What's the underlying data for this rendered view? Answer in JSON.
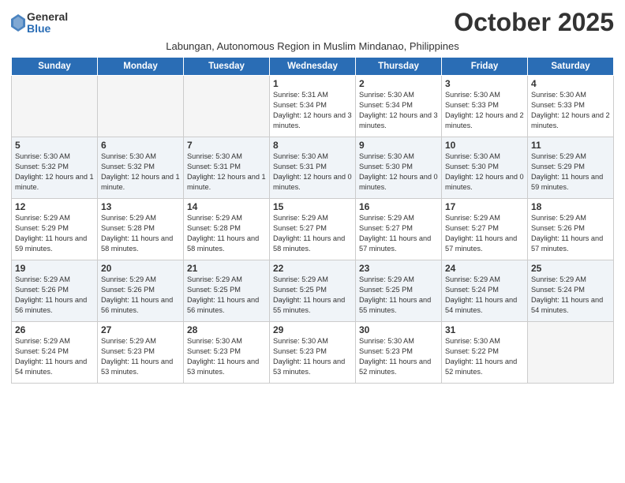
{
  "logo": {
    "general": "General",
    "blue": "Blue"
  },
  "title": "October 2025",
  "subtitle": "Labungan, Autonomous Region in Muslim Mindanao, Philippines",
  "headers": [
    "Sunday",
    "Monday",
    "Tuesday",
    "Wednesday",
    "Thursday",
    "Friday",
    "Saturday"
  ],
  "weeks": [
    [
      {
        "day": "",
        "info": ""
      },
      {
        "day": "",
        "info": ""
      },
      {
        "day": "",
        "info": ""
      },
      {
        "day": "1",
        "info": "Sunrise: 5:31 AM\nSunset: 5:34 PM\nDaylight: 12 hours and 3 minutes."
      },
      {
        "day": "2",
        "info": "Sunrise: 5:30 AM\nSunset: 5:34 PM\nDaylight: 12 hours and 3 minutes."
      },
      {
        "day": "3",
        "info": "Sunrise: 5:30 AM\nSunset: 5:33 PM\nDaylight: 12 hours and 2 minutes."
      },
      {
        "day": "4",
        "info": "Sunrise: 5:30 AM\nSunset: 5:33 PM\nDaylight: 12 hours and 2 minutes."
      }
    ],
    [
      {
        "day": "5",
        "info": "Sunrise: 5:30 AM\nSunset: 5:32 PM\nDaylight: 12 hours and 1 minute."
      },
      {
        "day": "6",
        "info": "Sunrise: 5:30 AM\nSunset: 5:32 PM\nDaylight: 12 hours and 1 minute."
      },
      {
        "day": "7",
        "info": "Sunrise: 5:30 AM\nSunset: 5:31 PM\nDaylight: 12 hours and 1 minute."
      },
      {
        "day": "8",
        "info": "Sunrise: 5:30 AM\nSunset: 5:31 PM\nDaylight: 12 hours and 0 minutes."
      },
      {
        "day": "9",
        "info": "Sunrise: 5:30 AM\nSunset: 5:30 PM\nDaylight: 12 hours and 0 minutes."
      },
      {
        "day": "10",
        "info": "Sunrise: 5:30 AM\nSunset: 5:30 PM\nDaylight: 12 hours and 0 minutes."
      },
      {
        "day": "11",
        "info": "Sunrise: 5:29 AM\nSunset: 5:29 PM\nDaylight: 11 hours and 59 minutes."
      }
    ],
    [
      {
        "day": "12",
        "info": "Sunrise: 5:29 AM\nSunset: 5:29 PM\nDaylight: 11 hours and 59 minutes."
      },
      {
        "day": "13",
        "info": "Sunrise: 5:29 AM\nSunset: 5:28 PM\nDaylight: 11 hours and 58 minutes."
      },
      {
        "day": "14",
        "info": "Sunrise: 5:29 AM\nSunset: 5:28 PM\nDaylight: 11 hours and 58 minutes."
      },
      {
        "day": "15",
        "info": "Sunrise: 5:29 AM\nSunset: 5:27 PM\nDaylight: 11 hours and 58 minutes."
      },
      {
        "day": "16",
        "info": "Sunrise: 5:29 AM\nSunset: 5:27 PM\nDaylight: 11 hours and 57 minutes."
      },
      {
        "day": "17",
        "info": "Sunrise: 5:29 AM\nSunset: 5:27 PM\nDaylight: 11 hours and 57 minutes."
      },
      {
        "day": "18",
        "info": "Sunrise: 5:29 AM\nSunset: 5:26 PM\nDaylight: 11 hours and 57 minutes."
      }
    ],
    [
      {
        "day": "19",
        "info": "Sunrise: 5:29 AM\nSunset: 5:26 PM\nDaylight: 11 hours and 56 minutes."
      },
      {
        "day": "20",
        "info": "Sunrise: 5:29 AM\nSunset: 5:26 PM\nDaylight: 11 hours and 56 minutes."
      },
      {
        "day": "21",
        "info": "Sunrise: 5:29 AM\nSunset: 5:25 PM\nDaylight: 11 hours and 56 minutes."
      },
      {
        "day": "22",
        "info": "Sunrise: 5:29 AM\nSunset: 5:25 PM\nDaylight: 11 hours and 55 minutes."
      },
      {
        "day": "23",
        "info": "Sunrise: 5:29 AM\nSunset: 5:25 PM\nDaylight: 11 hours and 55 minutes."
      },
      {
        "day": "24",
        "info": "Sunrise: 5:29 AM\nSunset: 5:24 PM\nDaylight: 11 hours and 54 minutes."
      },
      {
        "day": "25",
        "info": "Sunrise: 5:29 AM\nSunset: 5:24 PM\nDaylight: 11 hours and 54 minutes."
      }
    ],
    [
      {
        "day": "26",
        "info": "Sunrise: 5:29 AM\nSunset: 5:24 PM\nDaylight: 11 hours and 54 minutes."
      },
      {
        "day": "27",
        "info": "Sunrise: 5:29 AM\nSunset: 5:23 PM\nDaylight: 11 hours and 53 minutes."
      },
      {
        "day": "28",
        "info": "Sunrise: 5:30 AM\nSunset: 5:23 PM\nDaylight: 11 hours and 53 minutes."
      },
      {
        "day": "29",
        "info": "Sunrise: 5:30 AM\nSunset: 5:23 PM\nDaylight: 11 hours and 53 minutes."
      },
      {
        "day": "30",
        "info": "Sunrise: 5:30 AM\nSunset: 5:23 PM\nDaylight: 11 hours and 52 minutes."
      },
      {
        "day": "31",
        "info": "Sunrise: 5:30 AM\nSunset: 5:22 PM\nDaylight: 11 hours and 52 minutes."
      },
      {
        "day": "",
        "info": ""
      }
    ]
  ]
}
